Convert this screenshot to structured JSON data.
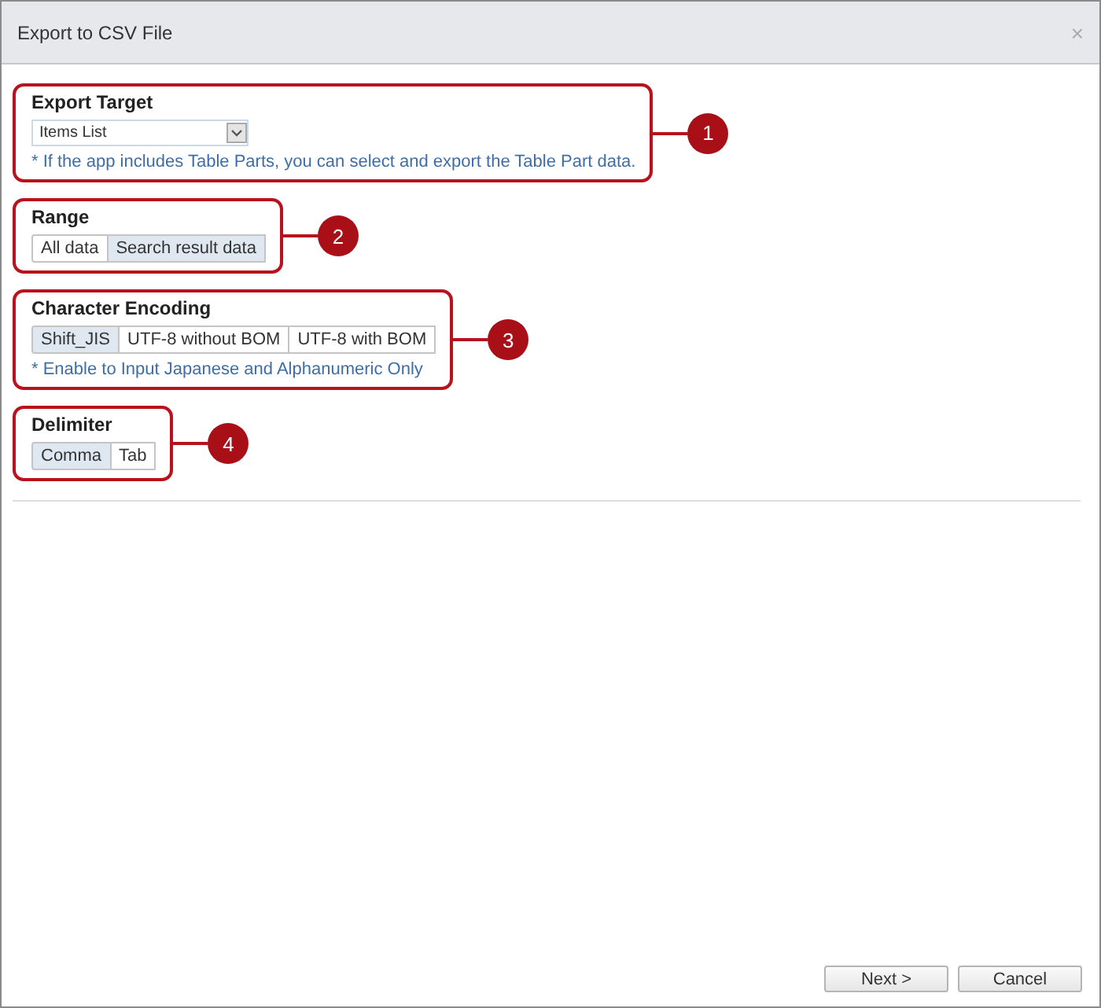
{
  "window": {
    "title": "Export to CSV File",
    "close": "×"
  },
  "sections": [
    {
      "kind": "select",
      "heading": "Export Target",
      "marker": "1",
      "select": {
        "value": "Items List"
      },
      "note": "* If the app includes Table Parts, you can select and export the Table Part data."
    },
    {
      "kind": "segments",
      "heading": "Range",
      "marker": "2",
      "options": [
        {
          "label": "All data",
          "selected": false
        },
        {
          "label": "Search result data",
          "selected": true
        }
      ]
    },
    {
      "kind": "segments",
      "heading": "Character Encoding",
      "marker": "3",
      "options": [
        {
          "label": "Shift_JIS",
          "selected": true
        },
        {
          "label": "UTF-8 without BOM",
          "selected": false
        },
        {
          "label": "UTF-8 with BOM",
          "selected": false
        }
      ],
      "note": "* Enable to Input Japanese and Alphanumeric Only"
    },
    {
      "kind": "segments",
      "heading": "Delimiter",
      "marker": "4",
      "options": [
        {
          "label": "Comma",
          "selected": true
        },
        {
          "label": "Tab",
          "selected": false
        }
      ]
    }
  ],
  "buttons": [
    "Next >",
    "Cancel"
  ]
}
